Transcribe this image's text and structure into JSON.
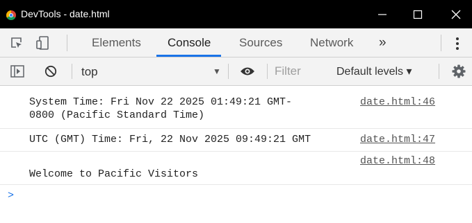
{
  "window": {
    "title": "DevTools - date.html",
    "app_icon": "chrome-icon",
    "controls": [
      "minimize-icon",
      "maximize-icon",
      "close-icon"
    ]
  },
  "tabbar": {
    "tools": [
      "inspect-element-icon",
      "device-toolbar-icon"
    ],
    "tabs": [
      {
        "label": "Elements",
        "active": false
      },
      {
        "label": "Console",
        "active": true
      },
      {
        "label": "Sources",
        "active": false
      },
      {
        "label": "Network",
        "active": false
      }
    ],
    "more": "»",
    "menu_icon": "kebab-menu-icon",
    "accent_color": "#1a73e8"
  },
  "console_toolbar": {
    "icons": [
      "show-sidebar-icon",
      "clear-console-icon",
      "live-expression-icon",
      "settings-gear-icon"
    ],
    "context": "top",
    "filter_placeholder": "Filter",
    "levels_label": "Default levels ▾"
  },
  "messages": [
    {
      "text": "System Time: Fri Nov 22 2025 01:49:21 GMT-\n0800 (Pacific Standard Time)",
      "source": "date.html:46"
    },
    {
      "text": "UTC (GMT) Time: Fri, 22 Nov 2025 09:49:21 GMT",
      "source": "date.html:47"
    },
    {
      "text": "\nWelcome to Pacific Visitors",
      "source": "date.html:48"
    }
  ],
  "prompt": ">"
}
